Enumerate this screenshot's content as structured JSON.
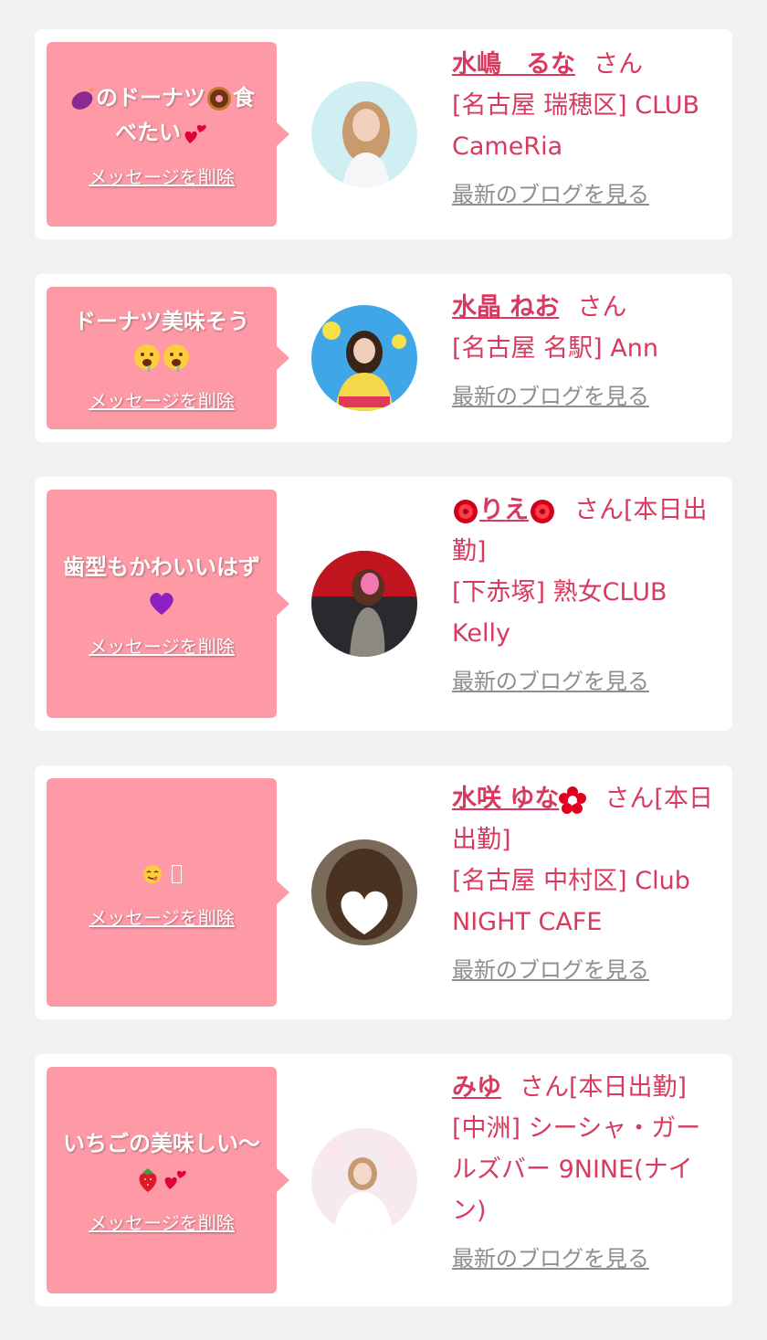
{
  "delete_label": "メッセージを削除",
  "blog_label": "最新のブログを見る",
  "cards": [
    {
      "message_pre": "",
      "message_mid": "のドーナツ",
      "message_post": "食べたい",
      "name": "水嶋　るな",
      "san": "さん",
      "shop": "[名古屋 瑞穂区] CLUB CameRia"
    },
    {
      "message": "ドーナツ美味そう",
      "name": "水晶 ねお",
      "san": "さん",
      "shop": "[名古屋 名駅] Ann"
    },
    {
      "message": "歯型もかわいいはず",
      "name": "りえ",
      "san": "さん[本日出勤]",
      "shop": "[下赤塚] 熟女CLUB Kelly"
    },
    {
      "message": "",
      "name": "水咲 ゆな",
      "san": "さん[本日出勤]",
      "shop": "[名古屋 中村区] Club NIGHT CAFE"
    },
    {
      "message": "いちごの美味しい〜",
      "name": "みゆ",
      "san": "さん[本日出勤]",
      "shop": "[中洲] シーシャ・ガールズバー 9NINE(ナイン)"
    }
  ]
}
